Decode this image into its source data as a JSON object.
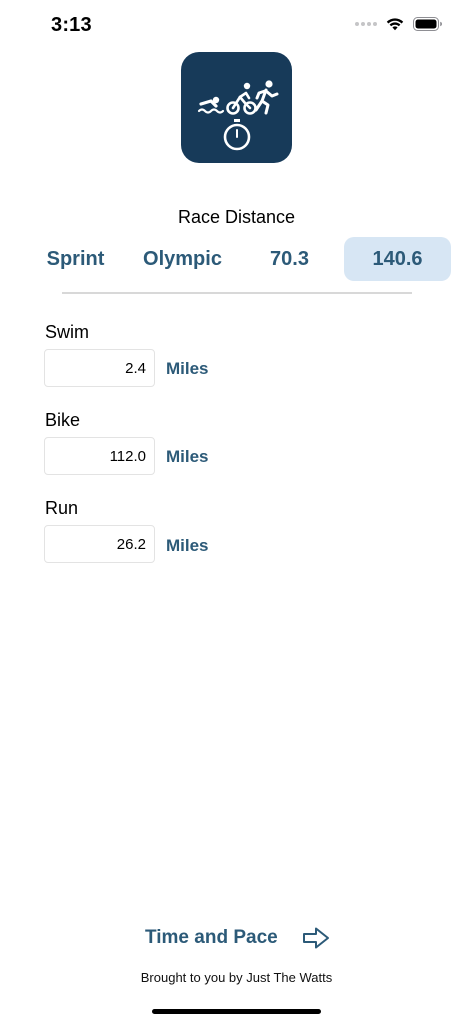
{
  "status": {
    "time": "3:13"
  },
  "race": {
    "title": "Race Distance",
    "options": [
      {
        "label": "Sprint",
        "selected": false
      },
      {
        "label": "Olympic",
        "selected": false
      },
      {
        "label": "70.3",
        "selected": false
      },
      {
        "label": "140.6",
        "selected": true
      }
    ]
  },
  "fields": {
    "swim": {
      "label": "Swim",
      "value": "2.4",
      "unit": "Miles"
    },
    "bike": {
      "label": "Bike",
      "value": "112.0",
      "unit": "Miles"
    },
    "run": {
      "label": "Run",
      "value": "26.2",
      "unit": "Miles"
    }
  },
  "next": {
    "label": "Time and Pace"
  },
  "footer": {
    "text": "Brought to you by Just The Watts"
  },
  "colors": {
    "accent": "#2c5a78",
    "logo_bg": "#173a59",
    "selected_bg": "#d7e6f4"
  },
  "icons": [
    "wifi-icon",
    "battery-icon",
    "triathlon-logo-icon",
    "stopwatch-icon",
    "arrow-right-icon"
  ]
}
